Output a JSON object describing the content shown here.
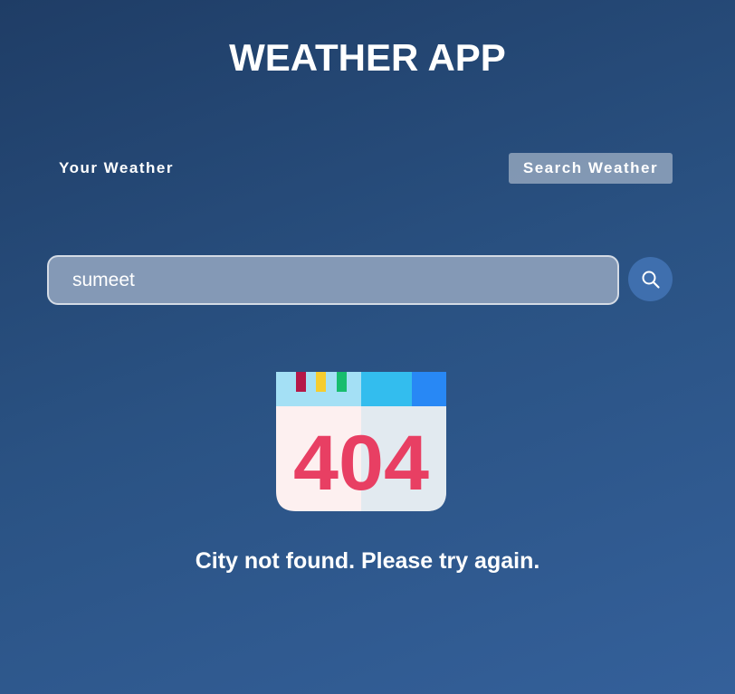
{
  "header": {
    "title": "WEATHER APP"
  },
  "tabs": [
    {
      "label": "Your Weather",
      "active": false
    },
    {
      "label": "Search Weather",
      "active": true
    }
  ],
  "search": {
    "value": "sumeet",
    "button_icon": "search-icon"
  },
  "error": {
    "image_text": "404",
    "image_icon": "calendar-404-icon",
    "message": "City not found. Please try again."
  },
  "colors": {
    "background_top": "#1f3d66",
    "background_bottom": "#34609a",
    "search_button": "#3f6fae",
    "active_tab": "rgba(255,255,255,0.42)"
  }
}
